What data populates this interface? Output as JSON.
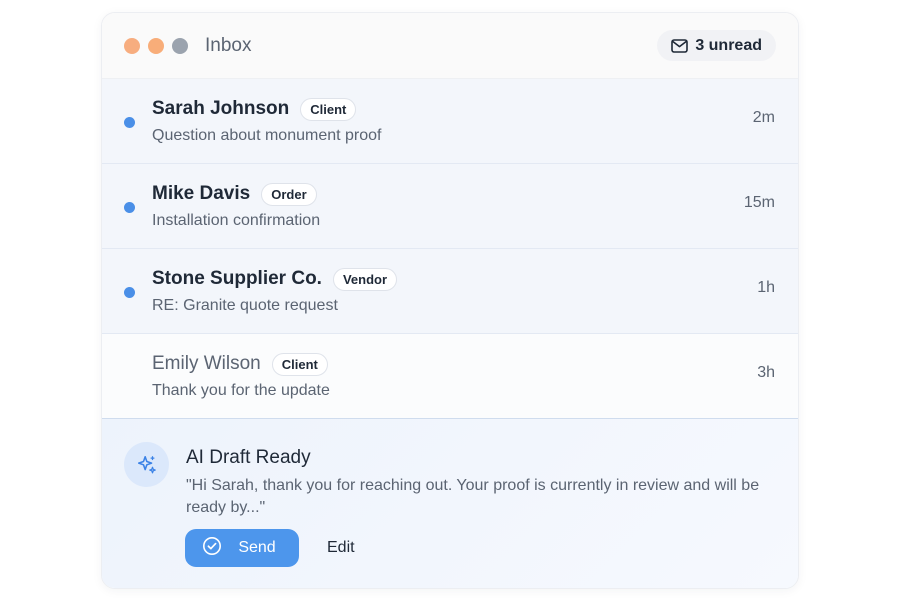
{
  "window": {
    "title": "Inbox",
    "traffic_lights": [
      "#f7ad7f",
      "#f8ad79",
      "#9ba3ae"
    ],
    "unread_badge": {
      "icon": "mail-icon",
      "label": "3 unread"
    }
  },
  "messages": [
    {
      "sender": "Sarah Johnson",
      "tag": "Client",
      "subject": "Question about monument proof",
      "time": "2m",
      "unread": true
    },
    {
      "sender": "Mike Davis",
      "tag": "Order",
      "subject": "Installation confirmation",
      "time": "15m",
      "unread": true
    },
    {
      "sender": "Stone Supplier Co.",
      "tag": "Vendor",
      "subject": "RE: Granite quote request",
      "time": "1h",
      "unread": true
    },
    {
      "sender": "Emily Wilson",
      "tag": "Client",
      "subject": "Thank you for the update",
      "time": "3h",
      "unread": false
    }
  ],
  "draft": {
    "icon": "sparkle-icon",
    "title": "AI Draft Ready",
    "text": "\"Hi Sarah, thank you for reaching out. Your proof is currently in review and will be ready by...\"",
    "send_label": "Send",
    "send_icon": "check-circle-icon",
    "edit_label": "Edit"
  },
  "colors": {
    "accent": "#4d96ec",
    "unread_dot": "#4a8fe7",
    "unread_row_bg": "#f3f6fb"
  }
}
